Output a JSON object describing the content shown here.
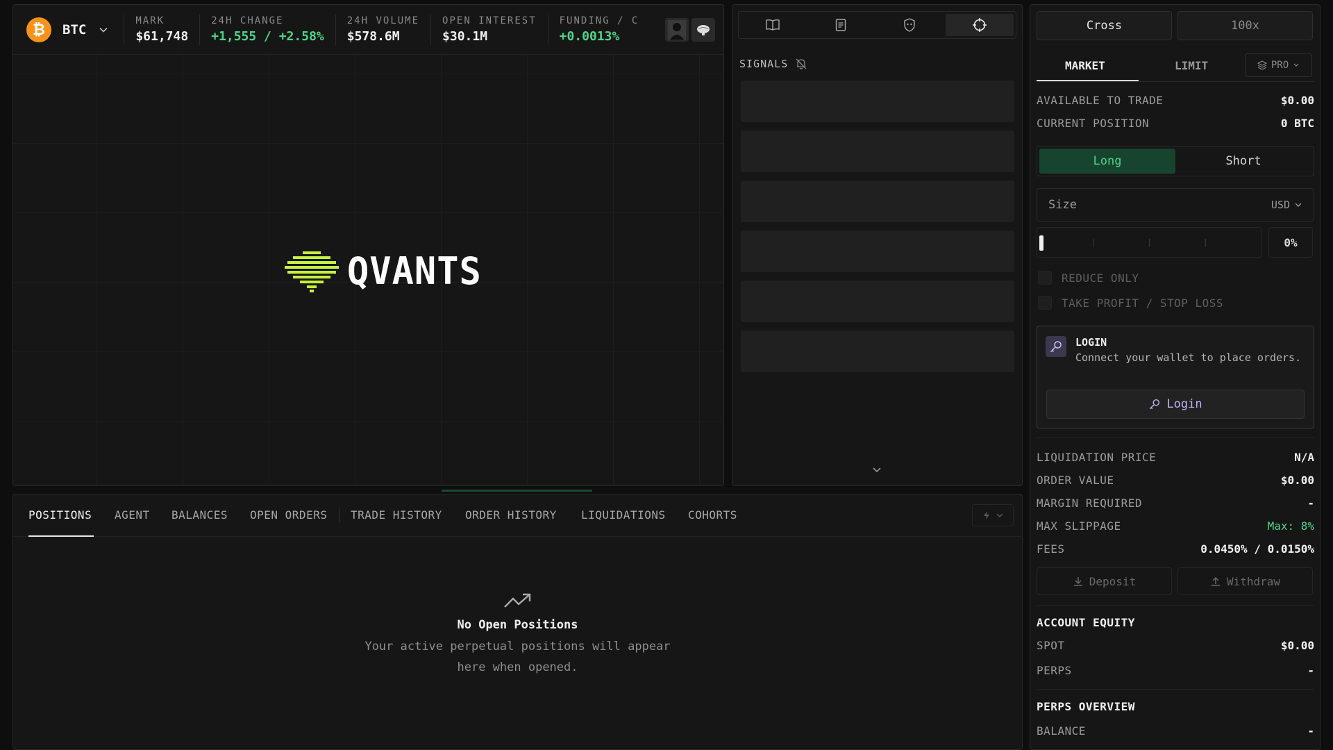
{
  "ticker": {
    "asset": "BTC",
    "stats": [
      {
        "label": "MARK",
        "value": "$61,748",
        "positive": false
      },
      {
        "label": "24H CHANGE",
        "value": "+1,555 / +2.58%",
        "positive": true
      },
      {
        "label": "24H VOLUME",
        "value": "$578.6M",
        "positive": false
      },
      {
        "label": "OPEN INTEREST",
        "value": "$30.1M",
        "positive": false
      },
      {
        "label": "FUNDING / C",
        "value": "+0.0013%",
        "positive": true
      }
    ]
  },
  "chart": {
    "logo_text": "QVANTS"
  },
  "signals": {
    "title": "SIGNALS",
    "tab_icons": [
      "book-icon",
      "document-icon",
      "shield-icon",
      "crosshair-icon"
    ]
  },
  "bottom": {
    "tabs": [
      "POSITIONS",
      "AGENT",
      "BALANCES",
      "OPEN ORDERS",
      "TRADE HISTORY",
      "ORDER HISTORY",
      "LIQUIDATIONS",
      "COHORTS"
    ],
    "empty_title": "No Open Positions",
    "empty_desc": "Your active perpetual positions will appear here when opened."
  },
  "order": {
    "margin_mode": "Cross",
    "leverage": "100x",
    "tabs": {
      "market": "MARKET",
      "limit": "LIMIT",
      "pro": "PRO"
    },
    "available_label": "AVAILABLE TO TRADE",
    "available_value": "$0.00",
    "position_label": "CURRENT POSITION",
    "position_value": "0 BTC",
    "long_label": "Long",
    "short_label": "Short",
    "size_placeholder": "Size",
    "size_unit": "USD",
    "size_pct": "0%",
    "size_fraction": 0,
    "reduce_only": "REDUCE ONLY",
    "tp_sl": "TAKE PROFIT / STOP LOSS",
    "login_title": "LOGIN",
    "login_desc": "Connect your wallet to place orders.",
    "login_button": "Login",
    "liq_label": "LIQUIDATION PRICE",
    "liq_value": "N/A",
    "order_value_label": "ORDER VALUE",
    "order_value": "$0.00",
    "margin_label": "MARGIN REQUIRED",
    "margin_value": "-",
    "slippage_label": "MAX SLIPPAGE",
    "slippage_value": "Max: 8%",
    "fees_label": "FEES",
    "fees_value": "0.0450% / 0.0150%",
    "deposit": "Deposit",
    "withdraw": "Withdraw",
    "equity_title": "ACCOUNT EQUITY",
    "spot_label": "SPOT",
    "spot_value": "$0.00",
    "perps_label": "PERPS",
    "perps_value": "-",
    "overview_title": "PERPS OVERVIEW",
    "balance_label": "BALANCE",
    "balance_value": "-"
  },
  "colors": {
    "accent_green": "#4dd58a",
    "long_bg": "#17442f",
    "btc_orange": "#f7931a",
    "login_accent": "#b9b4f0"
  }
}
